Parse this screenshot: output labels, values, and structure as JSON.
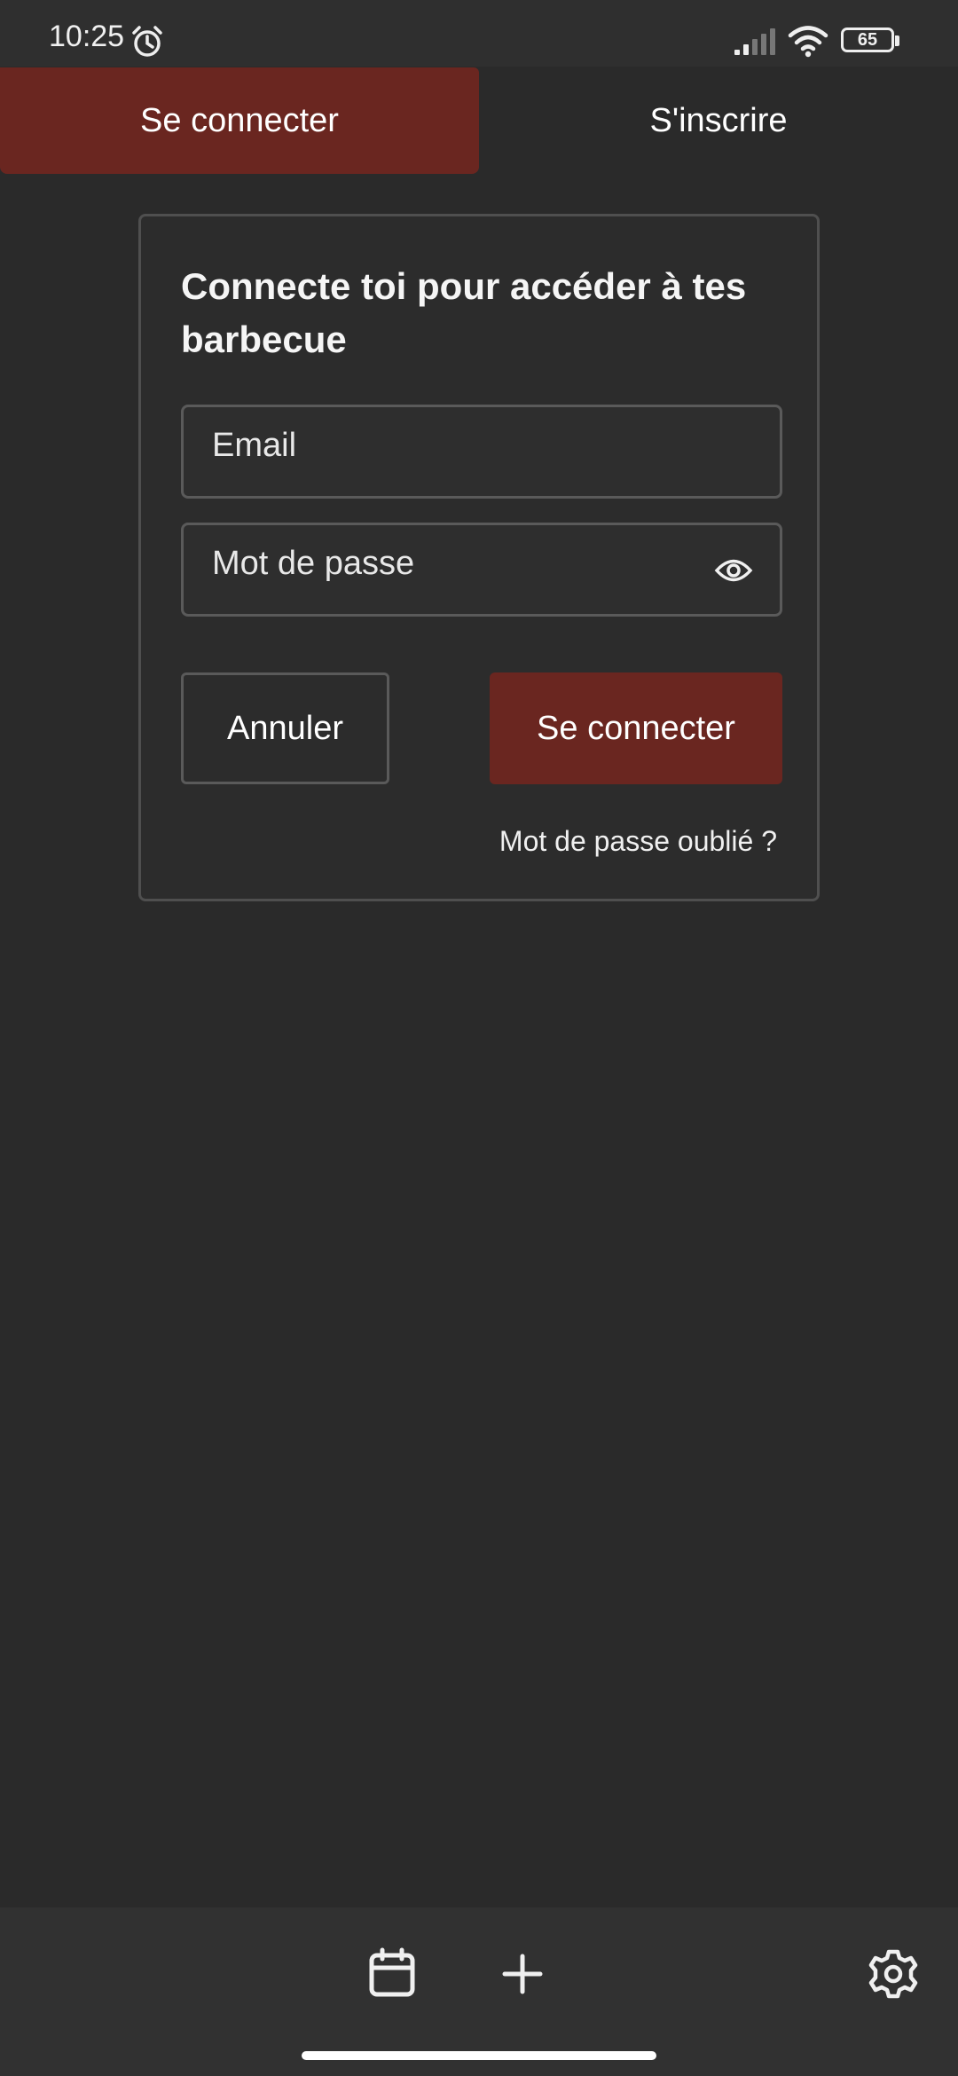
{
  "status_bar": {
    "time": "10:25",
    "battery_level": "65",
    "icons": [
      "alarm-icon",
      "signal-icon",
      "wifi-icon",
      "battery-icon"
    ]
  },
  "tabs": [
    {
      "label": "Se connecter",
      "active": true
    },
    {
      "label": "S'inscrire",
      "active": false
    }
  ],
  "login_card": {
    "title": "Connecte toi pour accéder à tes barbecue",
    "email_placeholder": "Email",
    "password_placeholder": "Mot de passe",
    "cancel_label": "Annuler",
    "submit_label": "Se connecter",
    "forgot_password_label": "Mot de passe oublié ?"
  },
  "bottom_nav": {
    "items": [
      "calendar-icon",
      "add-icon",
      "settings-icon"
    ]
  },
  "colors": {
    "background": "#2a2a2a",
    "accent": "#6a2620",
    "border": "#5a5a5a",
    "text": "#ffffff"
  }
}
